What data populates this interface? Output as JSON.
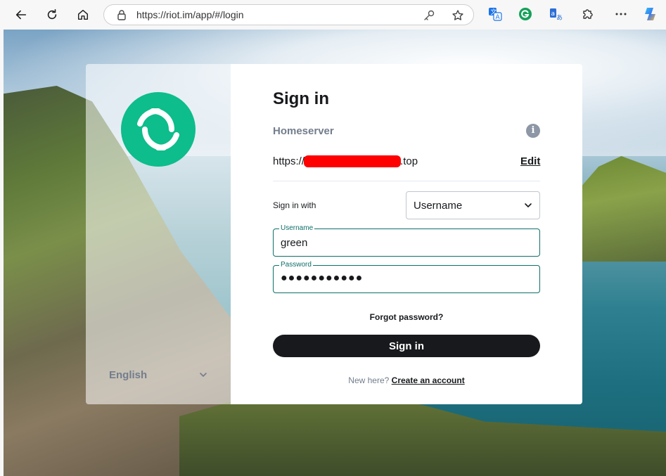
{
  "browser": {
    "url": "https://riot.im/app/#/login",
    "back_icon": "arrow-left-icon",
    "reload_icon": "reload-icon",
    "home_icon": "home-icon"
  },
  "left": {
    "language": "English"
  },
  "login": {
    "title": "Sign in",
    "homeserver_label": "Homeserver",
    "homeserver_prefix": "https://",
    "homeserver_suffix": ".top",
    "edit_label": "Edit",
    "sign_in_with_label": "Sign in with",
    "sign_in_with_value": "Username",
    "username_label": "Username",
    "username_value": "green",
    "password_label": "Password",
    "password_value": "●●●●●●●●●●●",
    "forgot_label": "Forgot password?",
    "submit_label": "Sign in",
    "new_here_label": "New here?",
    "create_account_label": "Create an account"
  },
  "colors": {
    "accent": "#0dbd8b",
    "field_border": "#0d6f6a",
    "button": "#17191c",
    "redaction": "#ff0000"
  }
}
